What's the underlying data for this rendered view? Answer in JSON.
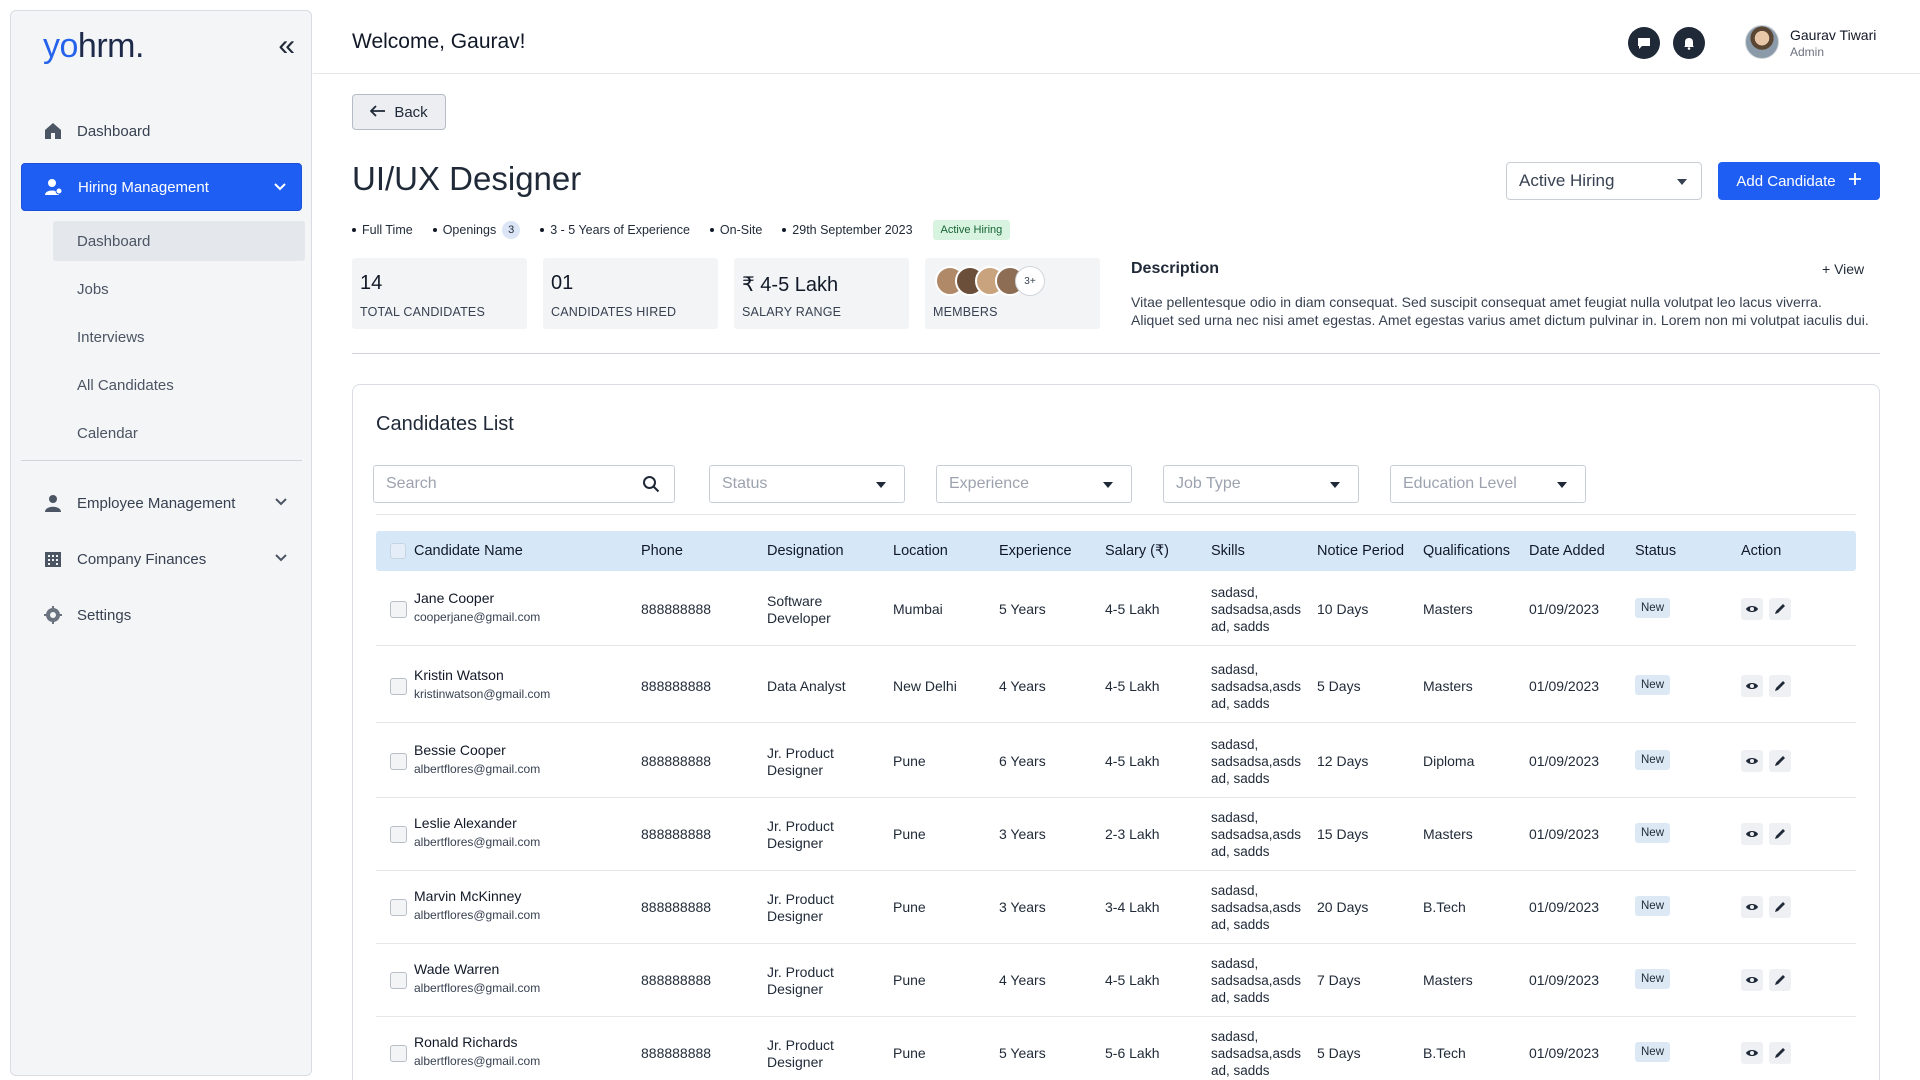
{
  "app": {
    "logo_prefix": "yo",
    "logo_suffix": "hrm."
  },
  "sidebar": {
    "items": [
      {
        "label": "Dashboard"
      },
      {
        "label": "Hiring Management"
      },
      {
        "label": "Employee Management"
      },
      {
        "label": "Company Finances"
      },
      {
        "label": "Settings"
      }
    ],
    "sub_items": [
      {
        "label": "Dashboard"
      },
      {
        "label": "Jobs"
      },
      {
        "label": "Interviews"
      },
      {
        "label": "All Candidates"
      },
      {
        "label": "Calendar"
      }
    ]
  },
  "header": {
    "welcome": "Welcome,  Gaurav!",
    "user_name": "Gaurav Tiwari",
    "user_role": "Admin"
  },
  "job": {
    "back_label": "Back",
    "title": "UI/UX Designer",
    "status_select": "Active Hiring",
    "add_label": "Add Candidate",
    "meta": {
      "type": "Full Time",
      "openings_label": "Openings",
      "openings_count": "3",
      "experience": "3 - 5 Years of Experience",
      "location": "On-Site",
      "date": "29th September 2023",
      "status": "Active Hiring"
    },
    "stats": [
      {
        "value": "14",
        "label": "TOTAL CANDIDATES"
      },
      {
        "value": "01",
        "label": "CANDIDATES HIRED"
      },
      {
        "value": "₹ 4-5 Lakh",
        "label": "SALARY RANGE"
      },
      {
        "value": "3+",
        "label": "MEMBERS"
      }
    ],
    "description_title": "Description",
    "view_label": "View",
    "description_line1": "Vitae pellentesque odio in diam consequat. Sed suscipit consequat amet feugiat nulla volutpat leo lacus viverra.",
    "description_line2": "Aliquet sed urna nec nisi amet egestas. Amet egestas varius amet dictum pulvinar in. Lorem non mi volutpat iaculis dui."
  },
  "candidates": {
    "title": "Candidates List",
    "filters": {
      "search_placeholder": "Search",
      "status": "Status",
      "experience": "Experience",
      "job_type": "Job Type",
      "education": "Education Level"
    },
    "columns": [
      "Candidate Name",
      "Phone",
      "Designation",
      "Location",
      "Experience",
      "Salary (₹)",
      "Skills",
      "Notice Period",
      "Qualifications",
      "Date Added",
      "Status",
      "Action"
    ],
    "rows": [
      {
        "name": "Jane Cooper",
        "email": "cooperjane@gmail.com",
        "phone": "888888888",
        "designation_1": "Software",
        "designation_2": "Developer",
        "location": "Mumbai",
        "experience": "5 Years",
        "salary": "4-5 Lakh",
        "skills_1": "sadasd,",
        "skills_2": "sadsadsa,asds",
        "skills_3": "ad, sadds",
        "notice": "10 Days",
        "qualification": "Masters",
        "date": "01/09/2023",
        "status": "New"
      },
      {
        "name": "Kristin Watson",
        "email": "kristinwatson@gmail.com",
        "phone": "888888888",
        "designation_1": "Data Analyst",
        "designation_2": "",
        "location": "New Delhi",
        "experience": "4 Years",
        "salary": "4-5 Lakh",
        "skills_1": "sadasd,",
        "skills_2": "sadsadsa,asds",
        "skills_3": "ad, sadds",
        "notice": "5 Days",
        "qualification": "Masters",
        "date": "01/09/2023",
        "status": "New"
      },
      {
        "name": "Bessie Cooper",
        "email": "albertflores@gmail.com",
        "phone": "888888888",
        "designation_1": "Jr. Product",
        "designation_2": "Designer",
        "location": "Pune",
        "experience": "6 Years",
        "salary": "4-5 Lakh",
        "skills_1": "sadasd,",
        "skills_2": "sadsadsa,asds",
        "skills_3": "ad, sadds",
        "notice": "12 Days",
        "qualification": "Diploma",
        "date": "01/09/2023",
        "status": "New"
      },
      {
        "name": "Leslie Alexander",
        "email": "albertflores@gmail.com",
        "phone": "888888888",
        "designation_1": "Jr. Product",
        "designation_2": "Designer",
        "location": "Pune",
        "experience": "3 Years",
        "salary": "2-3 Lakh",
        "skills_1": "sadasd,",
        "skills_2": "sadsadsa,asds",
        "skills_3": "ad, sadds",
        "notice": "15 Days",
        "qualification": "Masters",
        "date": "01/09/2023",
        "status": "New"
      },
      {
        "name": "Marvin McKinney",
        "email": "albertflores@gmail.com",
        "phone": "888888888",
        "designation_1": "Jr. Product",
        "designation_2": "Designer",
        "location": "Pune",
        "experience": "3 Years",
        "salary": "3-4 Lakh",
        "skills_1": "sadasd,",
        "skills_2": "sadsadsa,asds",
        "skills_3": "ad, sadds",
        "notice": "20 Days",
        "qualification": "B.Tech",
        "date": "01/09/2023",
        "status": "New"
      },
      {
        "name": "Wade Warren",
        "email": "albertflores@gmail.com",
        "phone": "888888888",
        "designation_1": "Jr. Product",
        "designation_2": "Designer",
        "location": "Pune",
        "experience": "4 Years",
        "salary": "4-5 Lakh",
        "skills_1": "sadasd,",
        "skills_2": "sadsadsa,asds",
        "skills_3": "ad, sadds",
        "notice": "7 Days",
        "qualification": "Masters",
        "date": "01/09/2023",
        "status": "New"
      },
      {
        "name": "Ronald Richards",
        "email": "albertflores@gmail.com",
        "phone": "888888888",
        "designation_1": "Jr. Product",
        "designation_2": "Designer",
        "location": "Pune",
        "experience": "5 Years",
        "salary": "5-6 Lakh",
        "skills_1": "sadasd,",
        "skills_2": "sadsadsa,asds",
        "skills_3": "ad, sadds",
        "notice": "5 Days",
        "qualification": "B.Tech",
        "date": "01/09/2023",
        "status": "New"
      }
    ]
  },
  "colors": {
    "primary": "#1f5ef3",
    "header_row": "#d6e8f8",
    "status_badge": "#dce9f5",
    "active_pill": "#d9f3e1"
  }
}
